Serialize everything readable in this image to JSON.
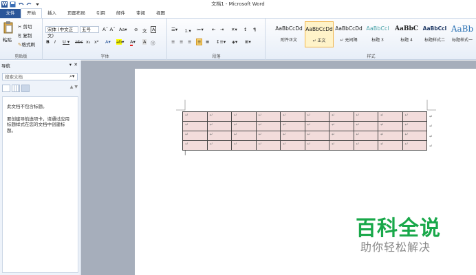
{
  "window": {
    "title": "文档1 - Microsoft Word"
  },
  "tabs": [
    "文件",
    "开始",
    "插入",
    "页面布局",
    "引用",
    "邮件",
    "审阅",
    "视图"
  ],
  "ribbon": {
    "clipboard": {
      "paste": "粘贴",
      "cut": "剪切",
      "copy": "复制",
      "format_painter": "格式刷",
      "label": "剪贴板"
    },
    "font": {
      "font_name": "宋体 (中文正文)",
      "font_size": "五号",
      "label": "字体"
    },
    "paragraph": {
      "label": "段落"
    },
    "styles": {
      "items": [
        {
          "preview": "AaBbCcDd",
          "name": "附件正文"
        },
        {
          "preview": "AaBbCcDd",
          "name": "↵ 正文"
        },
        {
          "preview": "AaBbCcDd",
          "name": "↵ 无间隔"
        },
        {
          "preview": "AaBbCcl",
          "name": "标题 3"
        },
        {
          "preview": "AaBbC",
          "name": "标题 4"
        },
        {
          "preview": "AaBbCcI",
          "name": "标题样式二"
        },
        {
          "preview": "AaBb",
          "name": "标题样式一"
        }
      ],
      "label": "样式"
    }
  },
  "nav": {
    "title": "导航",
    "search_placeholder": "搜索文档",
    "message1": "此文档不包含标题。",
    "message2": "要创建导航选项卡，请通过应用标题样式在您的文档中创建标题。"
  },
  "table": {
    "rows": 4,
    "cols": 10,
    "cell_mark": "↵"
  },
  "watermark": {
    "line1": "百科全说",
    "line2": "助你轻松解决"
  }
}
